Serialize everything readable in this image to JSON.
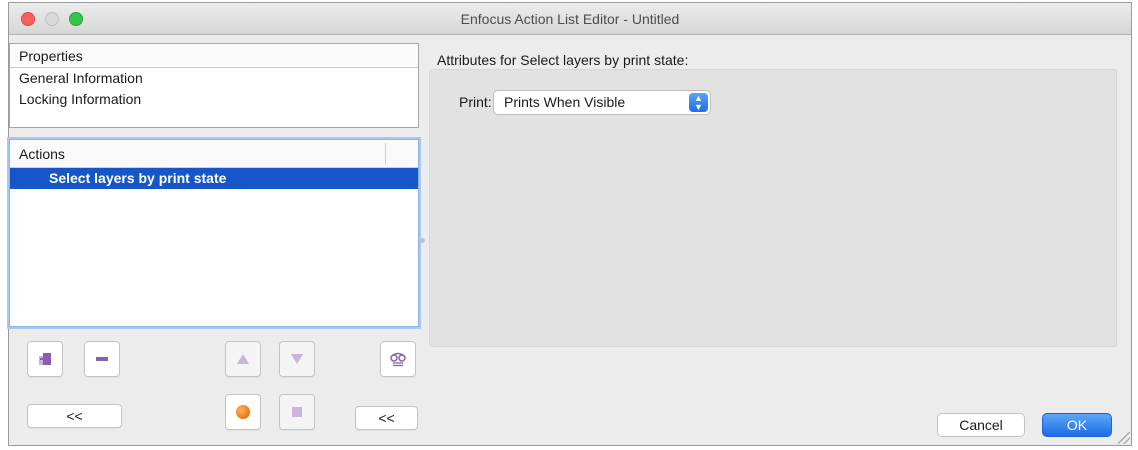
{
  "window": {
    "title": "Enfocus Action List Editor - Untitled"
  },
  "properties": {
    "header": "Properties",
    "items": [
      "General Information",
      "Locking Information"
    ]
  },
  "actions": {
    "header": "Actions",
    "items": [
      {
        "label": "Select layers by print state",
        "selected": true
      }
    ]
  },
  "toolbar": {
    "collapse_left_label": "<<",
    "collapse_right_label": "<<"
  },
  "attributes": {
    "heading": "Attributes for Select layers by print state:",
    "print_label": "Print:",
    "print_value": "Prints When Visible"
  },
  "dialog": {
    "cancel_label": "Cancel",
    "ok_label": "OK"
  },
  "colors": {
    "selection": "#1756c9",
    "accent_blue": "#1f6fe5",
    "record_orange": "#f07d1a",
    "icon_purple": "#8a5fb0",
    "disabled_purple": "#c9b4dc"
  }
}
